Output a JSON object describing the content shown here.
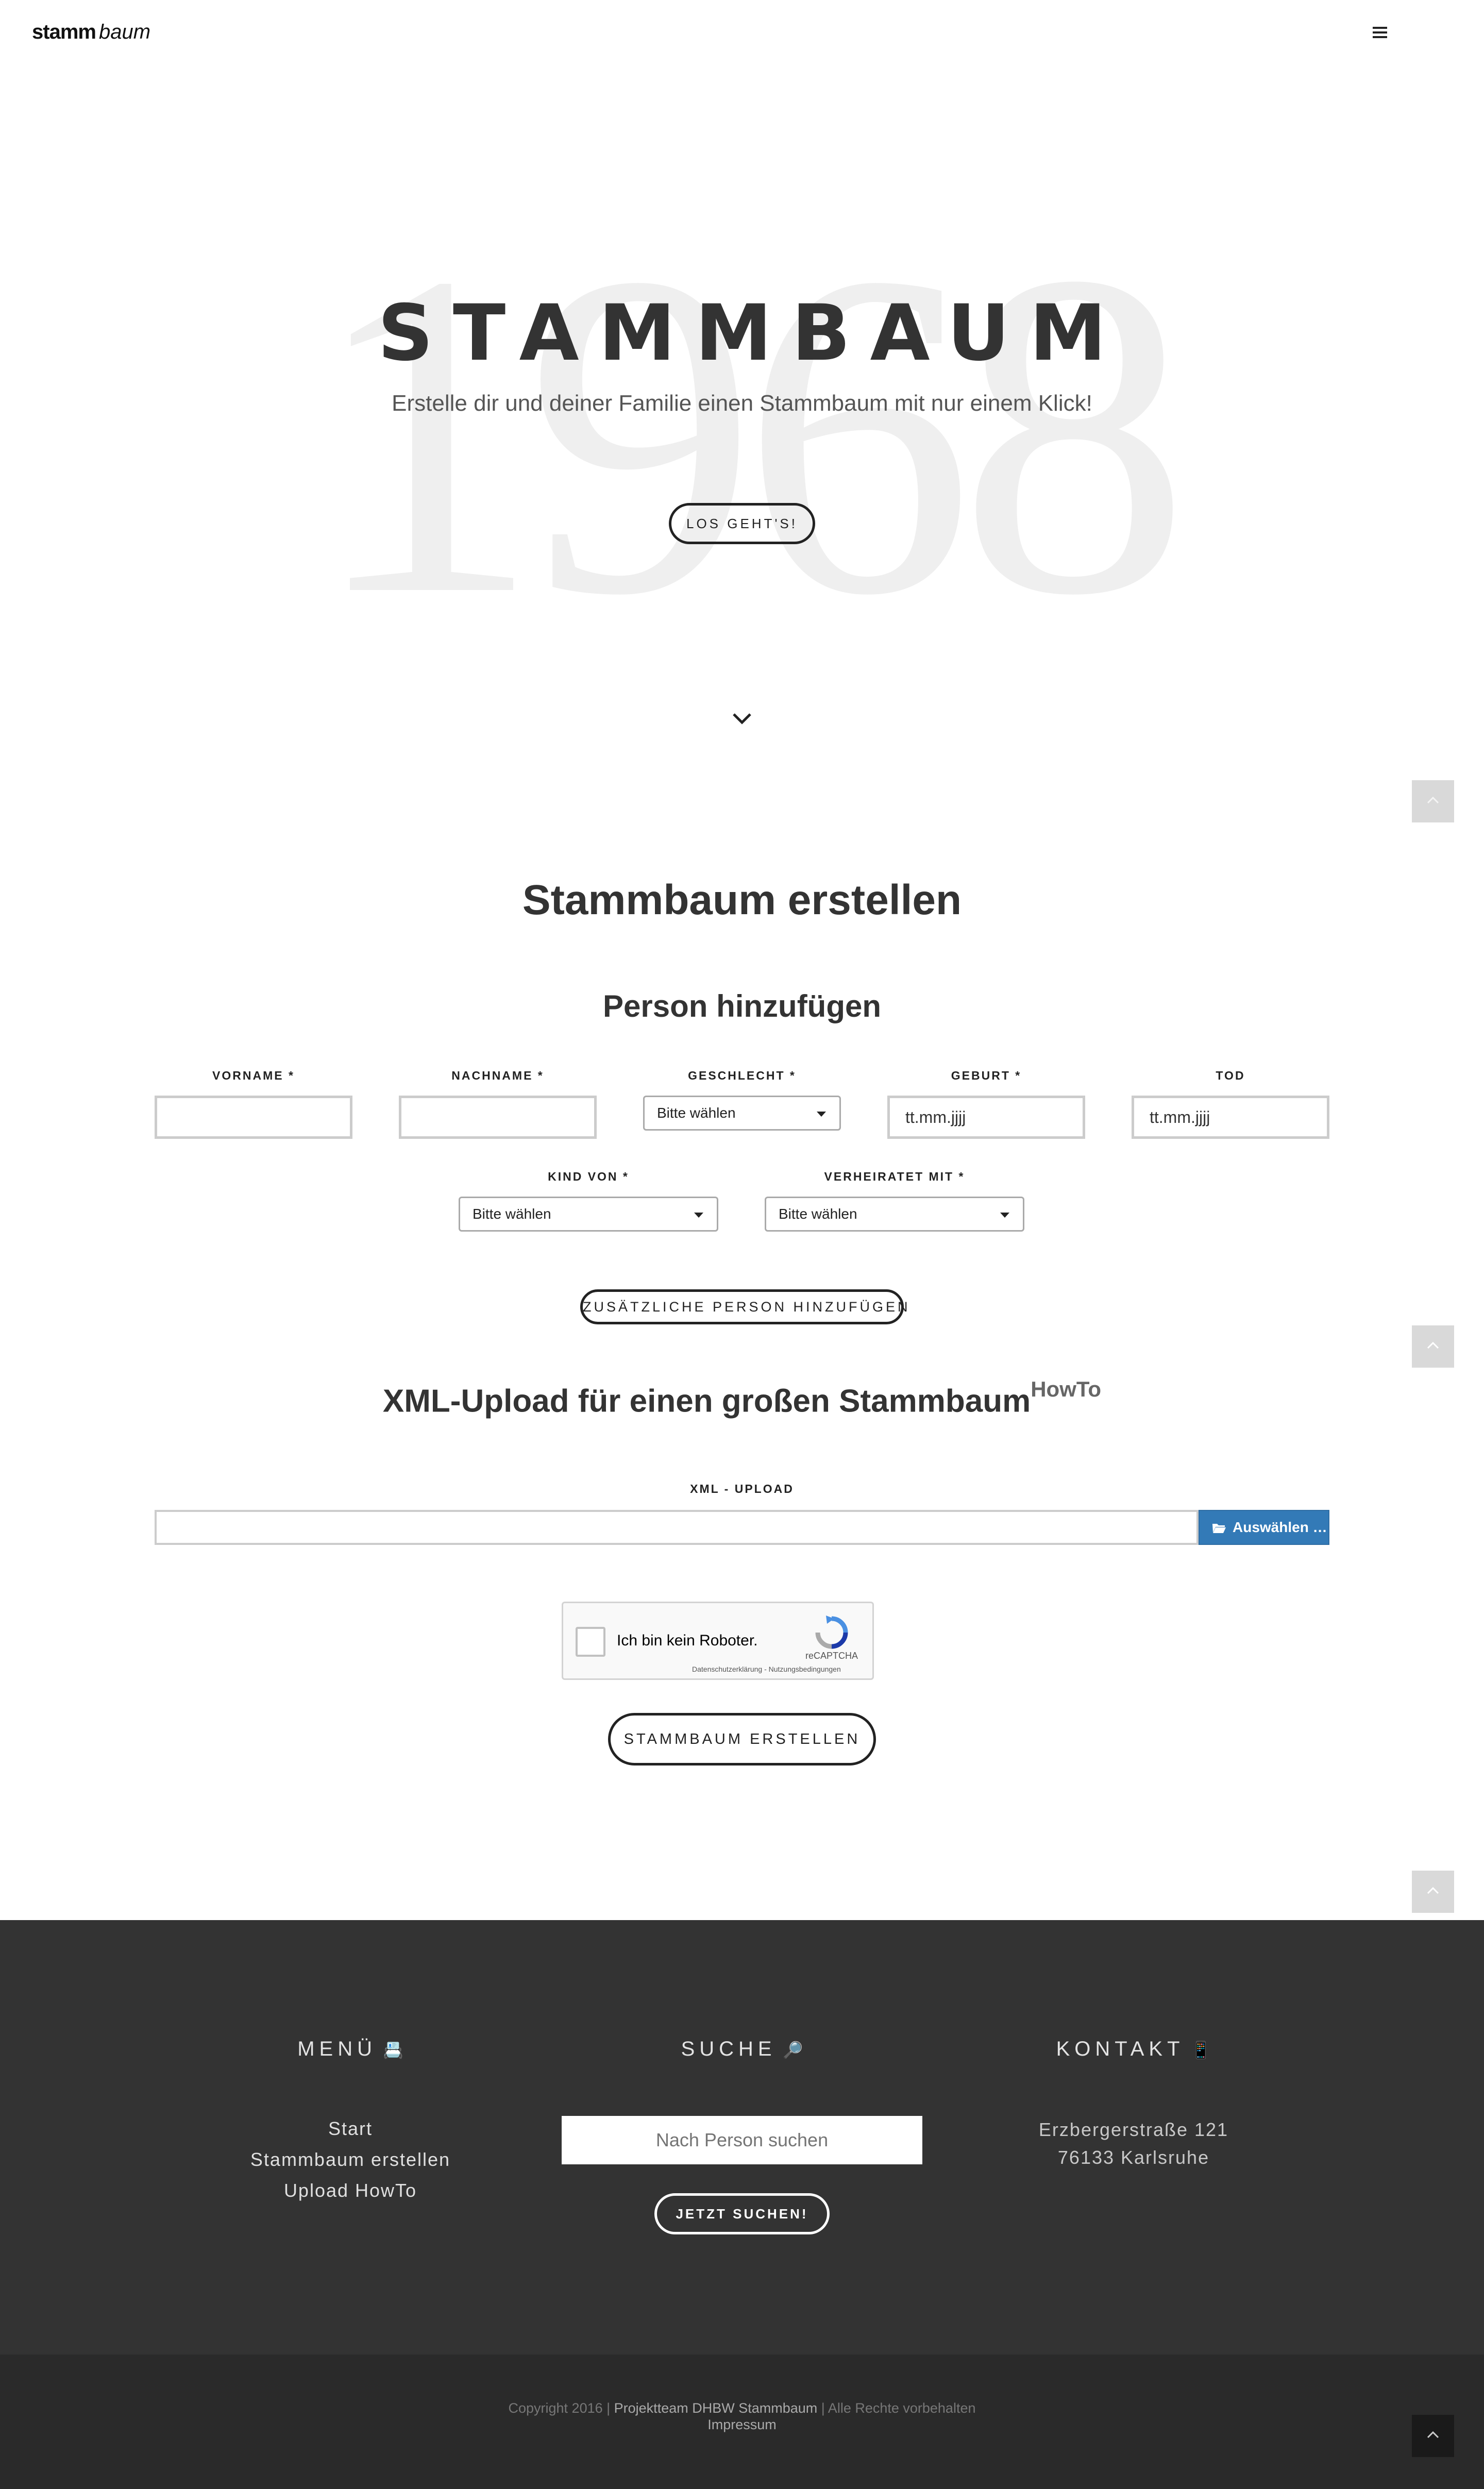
{
  "header": {
    "logo_bold": "stamm",
    "logo_italic": "baum",
    "menu_icon": "hamburger-icon"
  },
  "hero": {
    "background_year": "1968",
    "title": "STAMMBAUM",
    "subtitle": "Erstelle dir und deiner Familie einen Stammbaum mit nur einem Klick!",
    "button_label": "LOS GEHT'S!",
    "scroll_icon": "chevron-down-icon"
  },
  "form": {
    "heading": "Stammbaum erstellen",
    "subheading": "Person hinzufügen",
    "fields": {
      "vorname_label": "VORNAME *",
      "nachname_label": "NACHNAME *",
      "geschlecht_label": "GESCHLECHT *",
      "geschlecht_value": "Bitte wählen",
      "geburt_label": "GEBURT *",
      "geburt_placeholder": "tt.mm.jjjj",
      "tod_label": "TOD",
      "tod_placeholder": "tt.mm.jjjj",
      "kind_von_label": "KIND VON *",
      "kind_von_value": "Bitte wählen",
      "verheiratet_label": "VERHEIRATET MIT *",
      "verheiratet_value": "Bitte wählen"
    },
    "add_person_button": "ZUSÄTZLICHE PERSON HINZUFÜGEN",
    "xml_heading": "XML-Upload für einen großen Stammbaum",
    "xml_howto": "HowTo",
    "xml_label": "XML - UPLOAD",
    "upload_button": "Auswählen …",
    "captcha": {
      "text": "Ich bin kein Roboter.",
      "brand": "reCAPTCHA",
      "footer": "Datenschutzerklärung - Nutzungsbedingungen"
    },
    "submit_button": "STAMMBAUM ERSTELLEN"
  },
  "footer": {
    "menu_heading": "MENÜ",
    "menu_icon": "📇",
    "menu_items": [
      "Start",
      "Stammbaum erstellen",
      "Upload HowTo"
    ],
    "search_heading": "SUCHE",
    "search_icon": "🔎",
    "search_placeholder": "Nach Person suchen",
    "search_button": "JETZT SUCHEN!",
    "contact_heading": "KONTAKT",
    "contact_icon": "📱",
    "address_line1": "Erzbergerstraße 121",
    "address_line2": "76133 Karlsruhe"
  },
  "bottom": {
    "copyright_prefix": "Copyright 2016 |",
    "copyright_link": "Projektteam DHBW Stammbaum",
    "copyright_suffix": "| Alle Rechte vorbehalten",
    "impressum": "Impressum"
  },
  "colors": {
    "footer_bg": "#333333",
    "bottom_bg": "#2a2a2a",
    "upload_button": "#337ab7",
    "hero_year": "#efefef"
  }
}
